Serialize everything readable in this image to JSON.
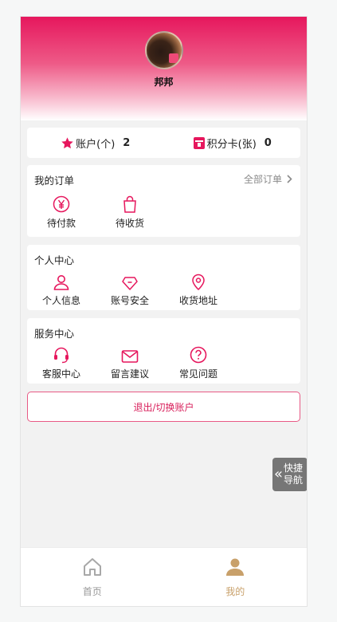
{
  "profile": {
    "username": "邦邦"
  },
  "stats": [
    {
      "label": "账户(个)",
      "value": "2",
      "icon": "star-icon"
    },
    {
      "label": "积分卡(张)",
      "value": "0",
      "icon": "points-card-icon"
    }
  ],
  "orders": {
    "title": "我的订单",
    "all_label": "全部订单",
    "items": [
      {
        "label": "待付款",
        "icon": "yen-icon"
      },
      {
        "label": "待收货",
        "icon": "shopping-bag-icon"
      }
    ]
  },
  "personal": {
    "title": "个人中心",
    "items": [
      {
        "label": "个人信息",
        "icon": "user-icon"
      },
      {
        "label": "账号安全",
        "icon": "shield-icon"
      },
      {
        "label": "收货地址",
        "icon": "location-pin-icon"
      }
    ]
  },
  "service": {
    "title": "服务中心",
    "items": [
      {
        "label": "客服中心",
        "icon": "headset-icon"
      },
      {
        "label": "留言建议",
        "icon": "mail-icon"
      },
      {
        "label": "常见问题",
        "icon": "question-icon"
      }
    ]
  },
  "logout_label": "退出/切换账户",
  "quick_nav": {
    "line1": "快捷",
    "line2": "导航"
  },
  "tabbar": [
    {
      "label": "首页",
      "icon": "home-icon"
    },
    {
      "label": "我的",
      "icon": "person-icon"
    }
  ],
  "colors": {
    "accent": "#e6175d",
    "tab_active": "#c8a06a",
    "tab_inactive": "#999999"
  }
}
